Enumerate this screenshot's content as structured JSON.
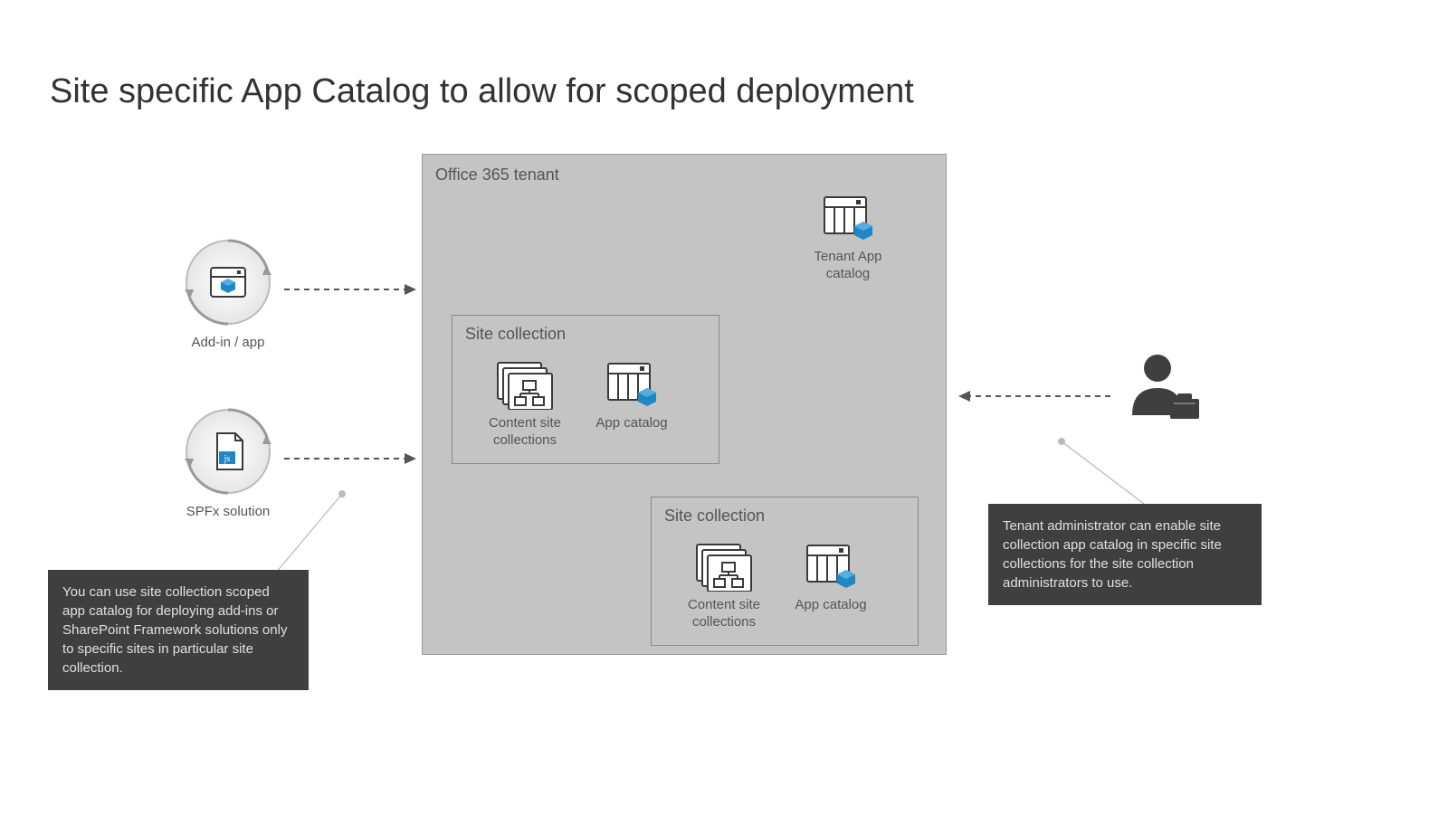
{
  "title": "Site specific App Catalog to allow for scoped deployment",
  "tenant": {
    "label": "Office 365 tenant"
  },
  "tenantCatalog": {
    "label": "Tenant App\ncatalog"
  },
  "siteCollection1": {
    "label": "Site collection",
    "content": "Content site\ncollections",
    "catalog": "App catalog"
  },
  "siteCollection2": {
    "label": "Site collection",
    "content": "Content site\ncollections",
    "catalog": "App catalog"
  },
  "addin": {
    "label": "Add-in / app"
  },
  "spfx": {
    "label": "SPFx solution"
  },
  "calloutLeft": "You can use site collection scoped app catalog for deploying add-ins or SharePoint Framework solutions only to specific sites in particular site collection.",
  "calloutRight": "Tenant administrator can enable site collection app catalog in specific site collections for the site collection administrators to use.",
  "colors": {
    "accent": "#1e88c7",
    "boxFill": "#c4c4c4",
    "calloutBg": "#3f3f3f",
    "iconStroke": "#3a3a3a"
  }
}
